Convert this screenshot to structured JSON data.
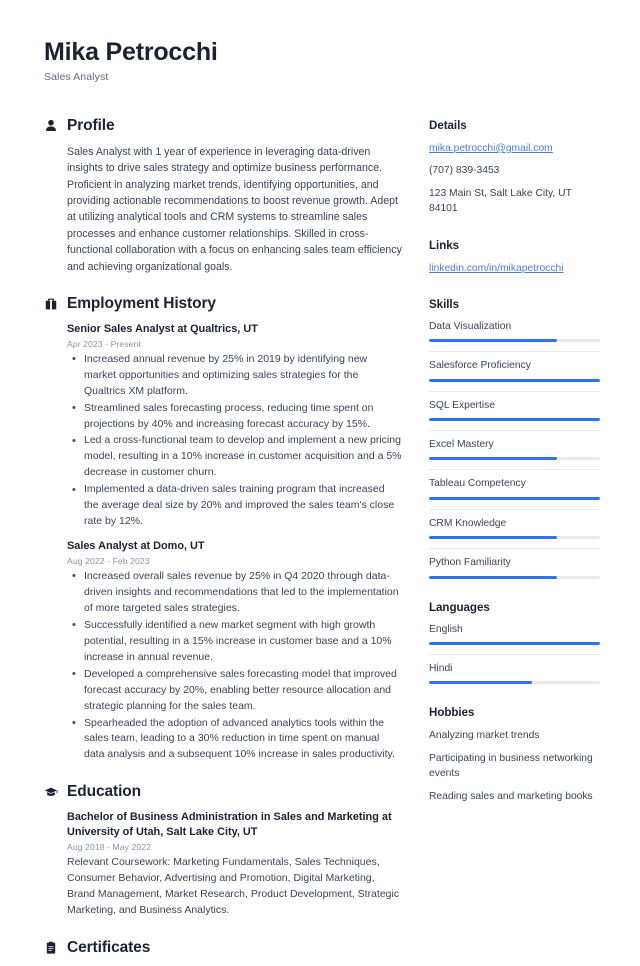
{
  "header": {
    "full_name": "Mika Petrocchi",
    "job_title": "Sales Analyst"
  },
  "accent_color": "#2e72f5",
  "link_color": "#4a7ddb",
  "main": {
    "profile": {
      "icon": "person-icon",
      "title": "Profile",
      "text": "Sales Analyst with 1 year of experience in leveraging data-driven insights to drive sales strategy and optimize business performance. Proficient in analyzing market trends, identifying opportunities, and providing actionable recommendations to boost revenue growth. Adept at utilizing analytical tools and CRM systems to streamline sales processes and enhance customer relationships. Skilled in cross-functional collaboration with a focus on enhancing sales team efficiency and achieving organizational goals."
    },
    "employment": {
      "icon": "briefcase-icon",
      "title": "Employment History",
      "entries": [
        {
          "title": "Senior Sales Analyst at Qualtrics, UT",
          "date": "Apr 2023 - Present",
          "bullets": [
            "Increased annual revenue by 25% in 2019 by identifying new market opportunities and optimizing sales strategies for the Qualtrics XM platform.",
            "Streamlined sales forecasting process, reducing time spent on projections by 40% and increasing forecast accuracy by 15%.",
            "Led a cross-functional team to develop and implement a new pricing model, resulting in a 10% increase in customer acquisition and a 5% decrease in customer churn.",
            "Implemented a data-driven sales training program that increased the average deal size by 20% and improved the sales team's close rate by 12%."
          ]
        },
        {
          "title": "Sales Analyst at Domo, UT",
          "date": "Aug 2022 - Feb 2023",
          "bullets": [
            "Increased overall sales revenue by 25% in Q4 2020 through data-driven insights and recommendations that led to the implementation of more targeted sales strategies.",
            "Successfully identified a new market segment with high growth potential, resulting in a 15% increase in customer base and a 10% increase in annual revenue.",
            "Developed a comprehensive sales forecasting model that improved forecast accuracy by 20%, enabling better resource allocation and strategic planning for the sales team.",
            "Spearheaded the adoption of advanced analytics tools within the sales team, leading to a 30% reduction in time spent on manual data analysis and a subsequent 10% increase in sales productivity."
          ]
        }
      ]
    },
    "education": {
      "icon": "graduation-cap-icon",
      "title": "Education",
      "entries": [
        {
          "title": "Bachelor of Business Administration in Sales and Marketing at University of Utah, Salt Lake City, UT",
          "date": "Aug 2018 - May 2022",
          "description": "Relevant Coursework: Marketing Fundamentals, Sales Techniques, Consumer Behavior, Advertising and Promotion, Digital Marketing, Brand Management, Market Research, Product Development, Strategic Marketing, and Business Analytics."
        }
      ]
    },
    "certificates": {
      "icon": "clipboard-icon",
      "title": "Certificates"
    }
  },
  "sidebar": {
    "details": {
      "title": "Details",
      "email": "mika.petrocchi@gmail.com",
      "phone": "(707) 839-3453",
      "address": "123 Main St, Salt Lake City, UT 84101"
    },
    "links": {
      "title": "Links",
      "items": [
        {
          "label": "linkedin.com/in/mikapetrocchi"
        }
      ]
    },
    "skills": {
      "title": "Skills",
      "items": [
        {
          "label": "Data Visualization",
          "level": 75
        },
        {
          "label": "Salesforce Proficiency",
          "level": 100
        },
        {
          "label": "SQL Expertise",
          "level": 100
        },
        {
          "label": "Excel Mastery",
          "level": 75
        },
        {
          "label": "Tableau Competency",
          "level": 100
        },
        {
          "label": "CRM Knowledge",
          "level": 75
        },
        {
          "label": "Python Familiarity",
          "level": 75
        }
      ]
    },
    "languages": {
      "title": "Languages",
      "items": [
        {
          "label": "English",
          "level": 100
        },
        {
          "label": "Hindi",
          "level": 60
        }
      ]
    },
    "hobbies": {
      "title": "Hobbies",
      "items": [
        {
          "label": "Analyzing market trends"
        },
        {
          "label": "Participating in business networking events"
        },
        {
          "label": "Reading sales and marketing books"
        }
      ]
    }
  }
}
